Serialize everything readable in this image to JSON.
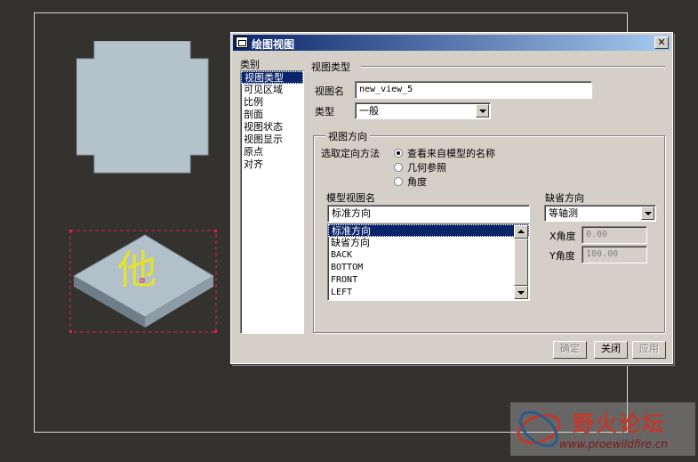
{
  "dialog": {
    "title": "绘图视图",
    "close_label": "✕",
    "category_label": "类别",
    "categories": [
      "视图类型",
      "可见区域",
      "比例",
      "剖面",
      "视图状态",
      "视图显示",
      "原点",
      "对齐"
    ],
    "section_title": "视图类型",
    "view_name_label": "视图名",
    "view_name_value": "new_view_5",
    "type_label": "类型",
    "type_value": "一般",
    "orientation_group_title": "视图方向",
    "orient_method_label": "选取定向方法",
    "orient_options": [
      "查看来自模型的名称",
      "几何参照",
      "角度"
    ],
    "model_view_name_label": "模型视图名",
    "model_view_name_value": "标准方向",
    "model_views": [
      "标准方向",
      "缺省方向",
      "BACK",
      "BOTTOM",
      "FRONT",
      "LEFT"
    ],
    "default_orient_label": "缺省方向",
    "default_orient_value": "等轴测",
    "x_angle_label": "X角度",
    "x_angle_value": "0.00",
    "y_angle_label": "Y角度",
    "y_angle_value": "180.00",
    "ok_label": "确定",
    "close_button_label": "关闭",
    "apply_label": "应用"
  },
  "canvas": {
    "annotation_text": "他"
  },
  "watermark": {
    "title": "野火论坛",
    "url": "www.proewildfire.cn"
  }
}
